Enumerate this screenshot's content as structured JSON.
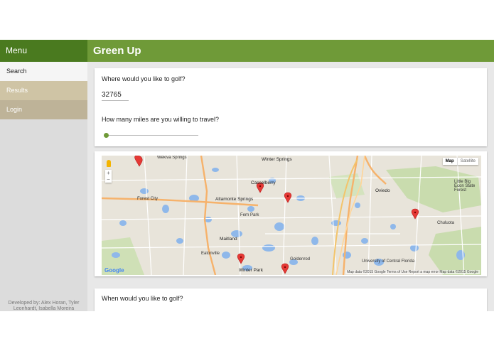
{
  "sidebar": {
    "menu_label": "Menu",
    "items": [
      {
        "label": "Search"
      },
      {
        "label": "Results"
      },
      {
        "label": "Login"
      }
    ],
    "credits": "Developed by: Alex Horan, Tyler Leonhardt, Isabella Moreira"
  },
  "header": {
    "title": "Green Up"
  },
  "search_card": {
    "zip_question": "Where would you like to golf?",
    "zip_value": "32765",
    "miles_question": "How many miles are you willing to travel?",
    "miles_slider_value_fraction": 0.0
  },
  "map": {
    "type_buttons": {
      "map": "Map",
      "satellite": "Satellite"
    },
    "zoom_in": "+",
    "zoom_out": "−",
    "footer": "Map data ©2015 Google   Terms of Use   Report a map error   Map data ©2015 Google",
    "logo": "Google",
    "places": {
      "wekiva_springs": "Wekiva Springs",
      "winter_springs": "Winter Springs",
      "casselberry": "Casselberry",
      "forest_city": "Forest City",
      "altamonte_springs": "Altamonte Springs",
      "fern_park": "Fern Park",
      "oviedo": "Oviedo",
      "maitland": "Maitland",
      "eatonville": "Eatonville",
      "winter_park": "Winter Park",
      "goldenrod": "Goldenrod",
      "chuluota": "Chuluota",
      "university": "University of Central Florida",
      "little_big_econ": "Little Big Econ State Forest"
    },
    "markers": 7
  },
  "when_card": {
    "question": "When would you like to golf?"
  },
  "colors": {
    "brand_dark": "#4a7a1f",
    "brand": "#6f9a38",
    "marker": "#e74c3c"
  }
}
